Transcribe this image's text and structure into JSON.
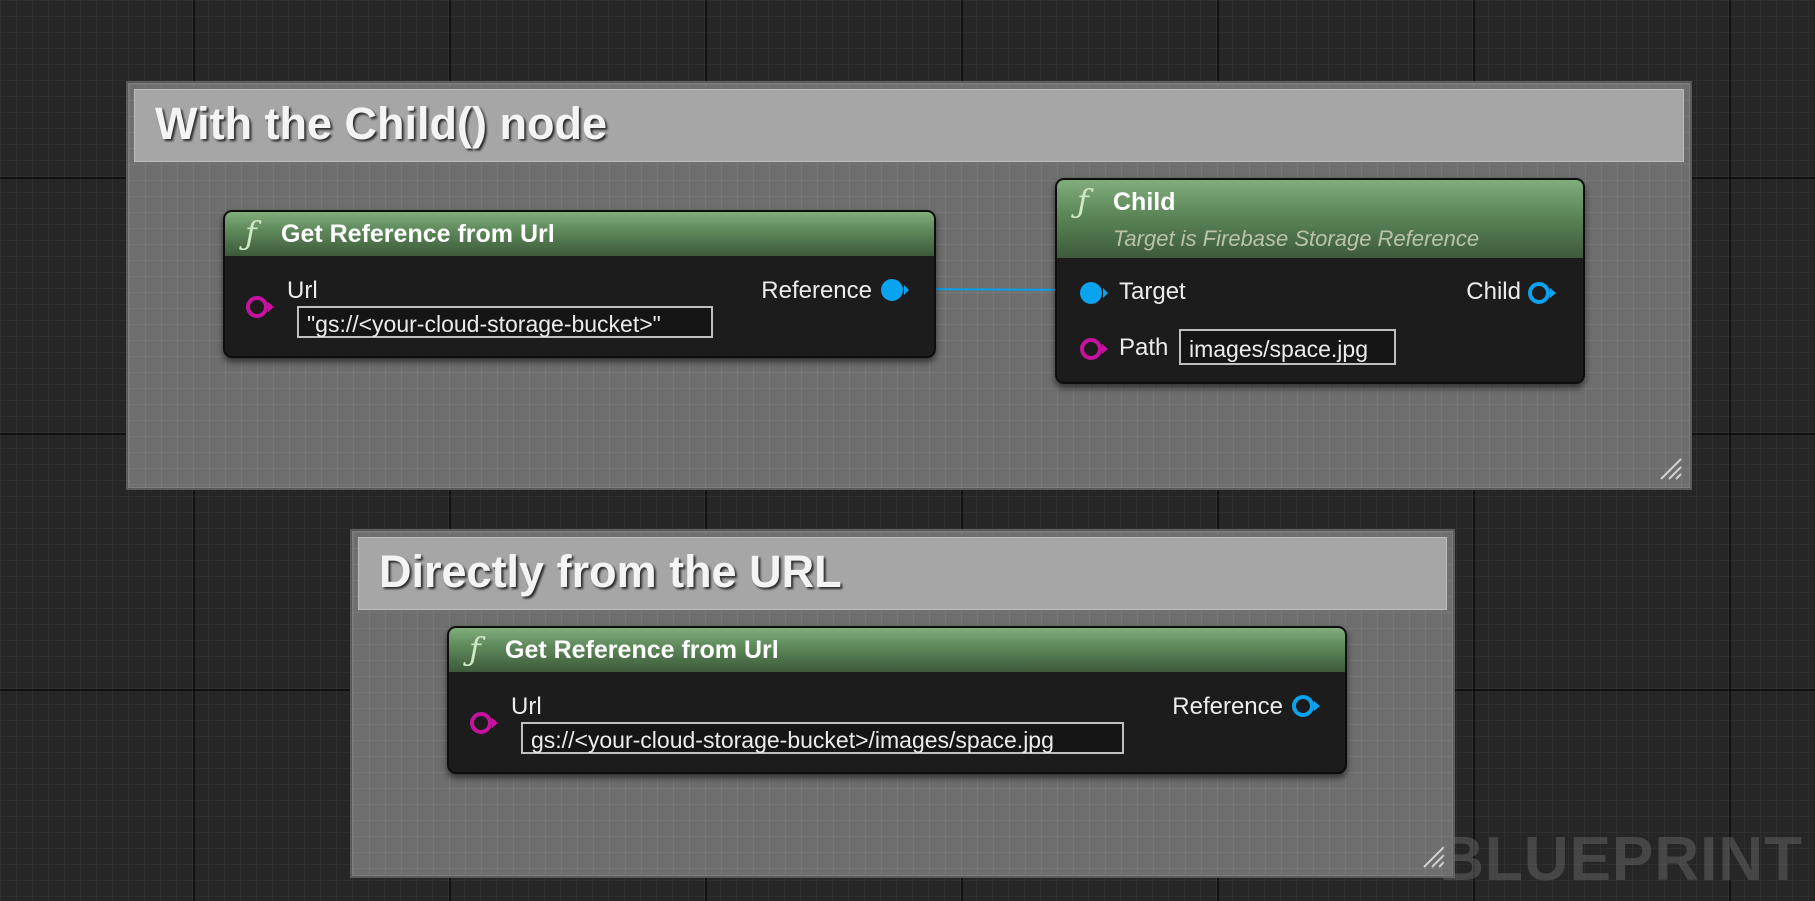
{
  "comments": [
    {
      "title": "With the Child() node"
    },
    {
      "title": "Directly from the URL"
    }
  ],
  "nodes": {
    "get_ref_1": {
      "title": "Get Reference from Url",
      "input_label": "Url",
      "input_value": "\"gs://<your-cloud-storage-bucket>\"",
      "output_label": "Reference"
    },
    "child": {
      "title": "Child",
      "subtitle": "Target is Firebase Storage Reference",
      "target_label": "Target",
      "path_label": "Path",
      "path_value": "images/space.jpg",
      "output_label": "Child"
    },
    "get_ref_2": {
      "title": "Get Reference from Url",
      "input_label": "Url",
      "input_value": "gs://<your-cloud-storage-bucket>/images/space.jpg",
      "output_label": "Reference"
    }
  },
  "icons": {
    "function": "function-icon",
    "string_pin": "string-pin-icon",
    "object_pin": "object-pin-icon",
    "resize": "resize-handle-icon"
  },
  "colors": {
    "string_pin": "#c7129f",
    "object_pin": "#0aa3f0",
    "wire": "#0a9ee8",
    "node_header": "#5f8a5b"
  },
  "watermark": "BLUEPRINT"
}
